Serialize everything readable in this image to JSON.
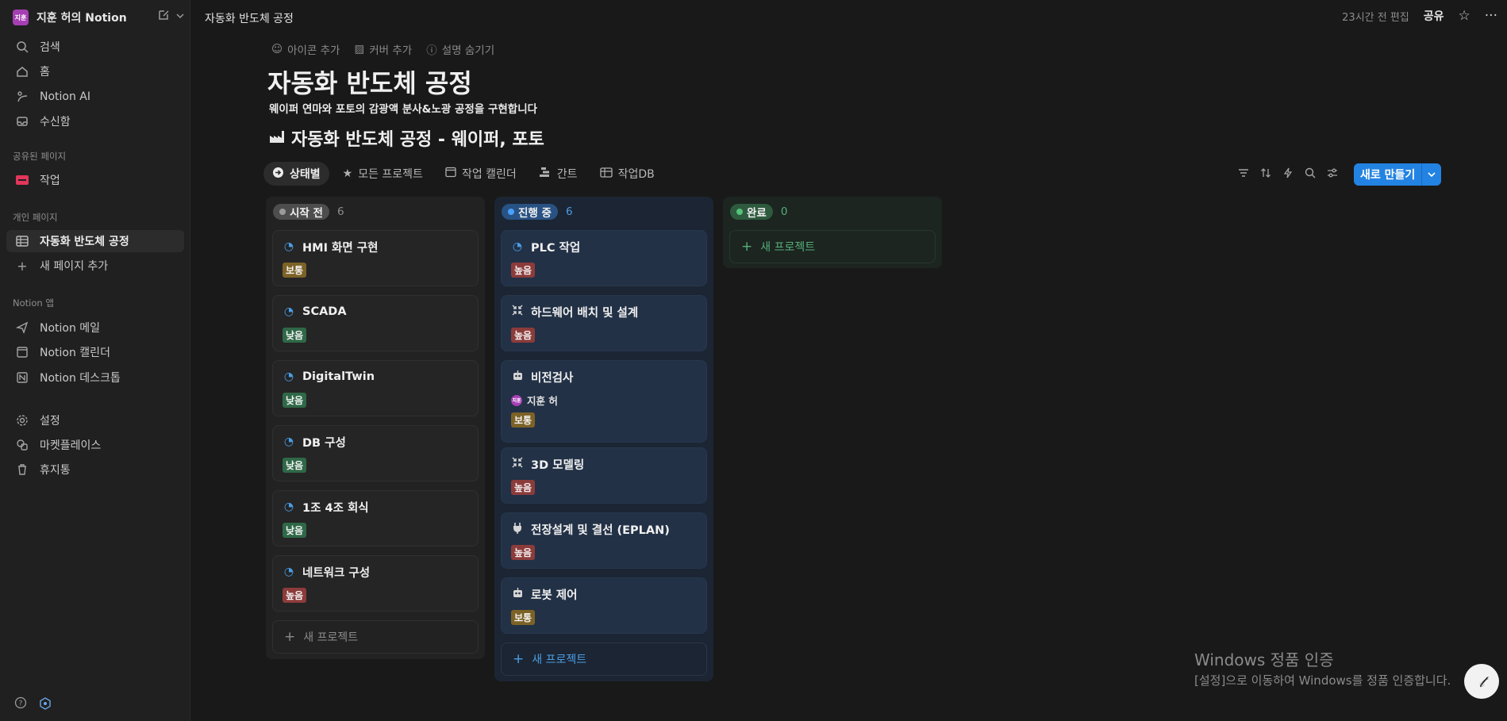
{
  "sidebar": {
    "workspace_avatar": "지훈",
    "workspace_name": "지훈 허의 Notion",
    "top_items": [
      {
        "label": "검색",
        "icon": "search-icon"
      },
      {
        "label": "홈",
        "icon": "home-icon"
      },
      {
        "label": "Notion AI",
        "icon": "notion-ai-icon"
      },
      {
        "label": "수신함",
        "icon": "inbox-icon"
      }
    ],
    "shared_label": "공유된 페이지",
    "shared_items": [
      {
        "label": "작업",
        "icon": "table-icon",
        "color": "#e2365a"
      }
    ],
    "private_label": "개인 페이지",
    "private_items": [
      {
        "label": "자동화 반도체 공정",
        "icon": "table-icon"
      },
      {
        "label": "새 페이지 추가",
        "icon": "plus-icon"
      }
    ],
    "apps_label": "Notion 앱",
    "app_items": [
      {
        "label": "Notion 메일",
        "icon": "send-icon"
      },
      {
        "label": "Notion 캘린더",
        "icon": "calendar-icon"
      },
      {
        "label": "Notion 데스크톱",
        "icon": "notion-icon"
      }
    ],
    "bottom_items": [
      {
        "label": "설정",
        "icon": "gear-icon"
      },
      {
        "label": "마켓플레이스",
        "icon": "marketplace-icon"
      },
      {
        "label": "휴지통",
        "icon": "trash-icon"
      }
    ]
  },
  "topbar": {
    "breadcrumb": "자동화 반도체 공정",
    "edited": "23시간 전 편집",
    "share": "공유"
  },
  "page": {
    "actions": [
      "아이콘 추가",
      "커버 추가",
      "설명 숨기기"
    ],
    "title": "자동화 반도체 공정",
    "description": "웨이퍼 연마와 포토의 감광액 분사&노광 공정을 구현합니다",
    "db_title": "자동화 반도체 공정 - 웨이퍼, 포토"
  },
  "views": {
    "tabs": [
      {
        "label": "상태별",
        "icon": "status-icon",
        "active": true
      },
      {
        "label": "모든 프로젝트",
        "icon": "star-icon"
      },
      {
        "label": "작업 캘린더",
        "icon": "calendar-icon"
      },
      {
        "label": "간트",
        "icon": "gantt-icon"
      },
      {
        "label": "작업DB",
        "icon": "table-icon"
      }
    ],
    "new_button": "새로 만들기"
  },
  "board": {
    "columns": [
      {
        "name": "시작 전",
        "count": "6",
        "color": "gray",
        "cards": [
          {
            "title": "HMI 화면 구현",
            "icon": "progress-icon",
            "priority": "보통"
          },
          {
            "title": "SCADA",
            "icon": "progress-icon",
            "priority": "낮음"
          },
          {
            "title": "DigitalTwin",
            "icon": "progress-icon",
            "priority": "낮음"
          },
          {
            "title": "DB 구성",
            "icon": "progress-icon",
            "priority": "낮음"
          },
          {
            "title": "1조 4조 회식",
            "icon": "progress-icon",
            "priority": "낮음"
          },
          {
            "title": "네트워크 구성",
            "icon": "progress-icon",
            "priority": "높음"
          }
        ],
        "new_label": "새 프로젝트"
      },
      {
        "name": "진행 중",
        "count": "6",
        "color": "blue",
        "cards": [
          {
            "title": "PLC 작업",
            "icon": "progress-icon",
            "priority": "높음"
          },
          {
            "title": "하드웨어 배치 및 설계",
            "icon": "compress-icon",
            "priority": "높음"
          },
          {
            "title": "비전검사",
            "icon": "robot-icon",
            "assignee": "지훈 허",
            "assignee_avatar": "지훈",
            "priority": "보통"
          },
          {
            "title": "3D 모델링",
            "icon": "compress-icon",
            "priority": "높음"
          },
          {
            "title": "전장설계 및 결선 (EPLAN)",
            "icon": "plug-icon",
            "priority": "높음"
          },
          {
            "title": "로봇 제어",
            "icon": "robot-icon",
            "priority": "보통"
          }
        ],
        "new_label": "새 프로젝트"
      },
      {
        "name": "완료",
        "count": "0",
        "color": "green",
        "cards": [],
        "new_label": "새 프로젝트"
      }
    ]
  },
  "watermark": {
    "line1": "Windows 정품 인증",
    "line2": "[설정]으로 이동하여 Windows를 정품 인증합니다."
  }
}
